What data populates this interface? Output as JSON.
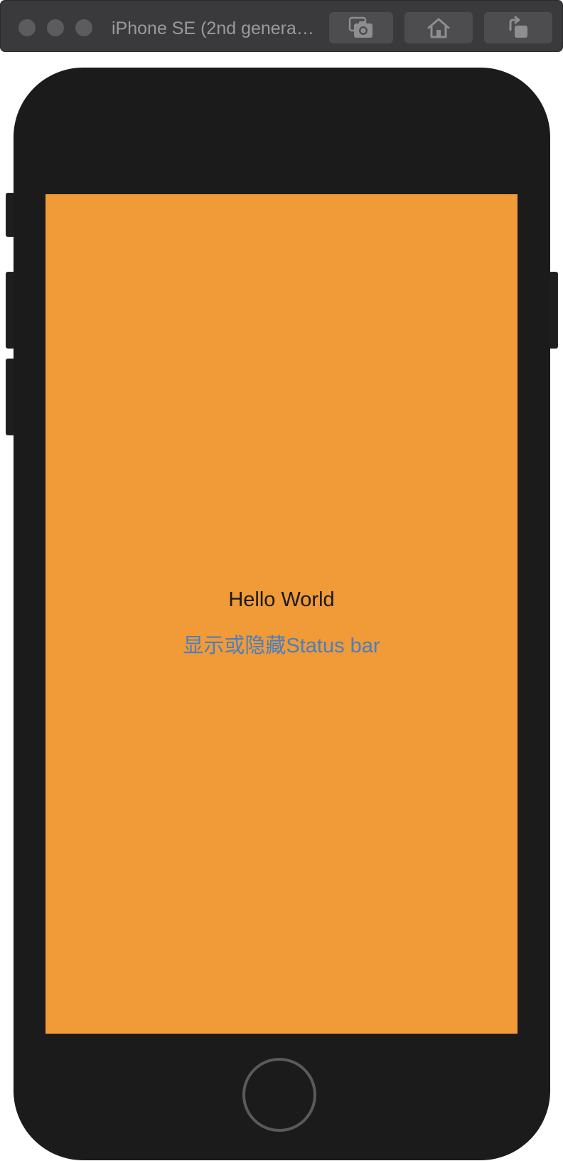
{
  "window": {
    "title": "iPhone SE (2nd genera…",
    "toolbar": {
      "screenshot_icon": "camera-icon",
      "home_icon": "home-icon",
      "rotate_icon": "rotate-icon"
    }
  },
  "app": {
    "greeting": "Hello World",
    "toggle_button_label": "显示或隐藏Status bar"
  },
  "colors": {
    "screen_background": "#f09a38",
    "link": "#4a7fbf",
    "device_body": "#1b1b1b"
  }
}
